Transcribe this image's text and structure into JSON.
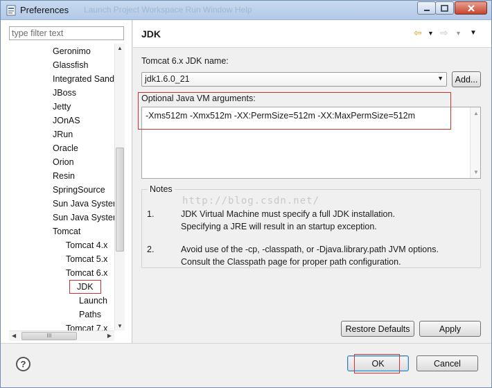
{
  "window": {
    "title": "Preferences",
    "ghost_title": "Launch   Project   Workspace   Run   Window   Help"
  },
  "sidebar": {
    "filter_placeholder": "type filter text",
    "items": [
      {
        "label": "Geronimo",
        "level": 1
      },
      {
        "label": "Glassfish",
        "level": 1
      },
      {
        "label": "Integrated Sandbox",
        "level": 1
      },
      {
        "label": "JBoss",
        "level": 1
      },
      {
        "label": "Jetty",
        "level": 1
      },
      {
        "label": "JOnAS",
        "level": 1
      },
      {
        "label": "JRun",
        "level": 1
      },
      {
        "label": "Oracle",
        "level": 1
      },
      {
        "label": "Orion",
        "level": 1
      },
      {
        "label": "Resin",
        "level": 1
      },
      {
        "label": "SpringSource",
        "level": 1
      },
      {
        "label": "Sun Java System",
        "level": 1
      },
      {
        "label": "Sun Java System",
        "level": 1
      },
      {
        "label": "Tomcat",
        "level": 1
      },
      {
        "label": "Tomcat 4.x",
        "level": 2
      },
      {
        "label": "Tomcat 5.x",
        "level": 2
      },
      {
        "label": "Tomcat 6.x",
        "level": 2
      },
      {
        "label": "JDK",
        "level": 3
      },
      {
        "label": "Launch",
        "level": 3
      },
      {
        "label": "Paths",
        "level": 3
      },
      {
        "label": "Tomcat 7.x",
        "level": 2
      }
    ],
    "hscroll_grip": "III"
  },
  "page": {
    "title": "JDK",
    "jdk_name_label": "Tomcat  6.x JDK name:",
    "jdk_selected": "jdk1.6.0_21",
    "add_label": "Add...",
    "vm_args_label": "Optional Java VM arguments:",
    "vm_args_value": "-Xms512m -Xmx512m -XX:PermSize=512m -XX:MaxPermSize=512m",
    "watermark": "http://blog.csdn.net/",
    "notes": {
      "title": "Notes",
      "items": [
        {
          "num": "1.",
          "lines": [
            "JDK Virtual Machine must specify a full JDK installation.",
            "Specifying a JRE will result in an startup exception."
          ]
        },
        {
          "num": "2.",
          "lines": [
            "Avoid use of the -cp, -classpath, or -Djava.library.path JVM options.",
            "Consult the Classpath page for proper path configuration."
          ]
        }
      ]
    },
    "restore_label": "Restore Defaults",
    "apply_label": "Apply"
  },
  "footer": {
    "help_glyph": "?",
    "ok_label": "OK",
    "cancel_label": "Cancel"
  },
  "colors": {
    "annotation": "#d23030",
    "titlebar": "#b9cfe9",
    "close_button": "#c7452c"
  },
  "icons": [
    "app-icon",
    "minimize-icon",
    "maximize-icon",
    "close-icon",
    "back-arrow-icon",
    "forward-arrow-icon",
    "menu-chevron-icon",
    "help-icon"
  ]
}
